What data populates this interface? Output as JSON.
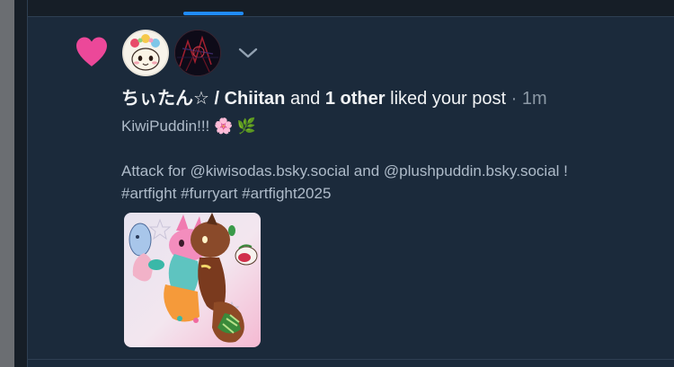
{
  "nav": {
    "active_tab_color": "#208bfe"
  },
  "notification": {
    "icon": "heart-icon",
    "icon_color": "#ec4899",
    "avatars": [
      {
        "icon": "chiitan-avatar"
      },
      {
        "icon": "dark-avatar"
      }
    ],
    "expand_icon": "chevron-down-icon",
    "actor_name": "ちぃたん☆ / Chiitan",
    "connector": "and",
    "others": "1 other",
    "action": "liked your post",
    "separator": "·",
    "time": "1m"
  },
  "post": {
    "title": "KiwiPuddin!!! 🌸 🌿",
    "body_line1": "Attack for @kiwisodas.bsky.social and @plushpuddin.bsky.social !",
    "body_line2": "#artfight #furryart #artfight2025",
    "image_alt": "illustration of two furry characters hugging"
  },
  "colors": {
    "background": "#1b2a3b",
    "text": "#f1f3f5",
    "muted_text": "#aebbc9",
    "border": "#2e3f52"
  }
}
